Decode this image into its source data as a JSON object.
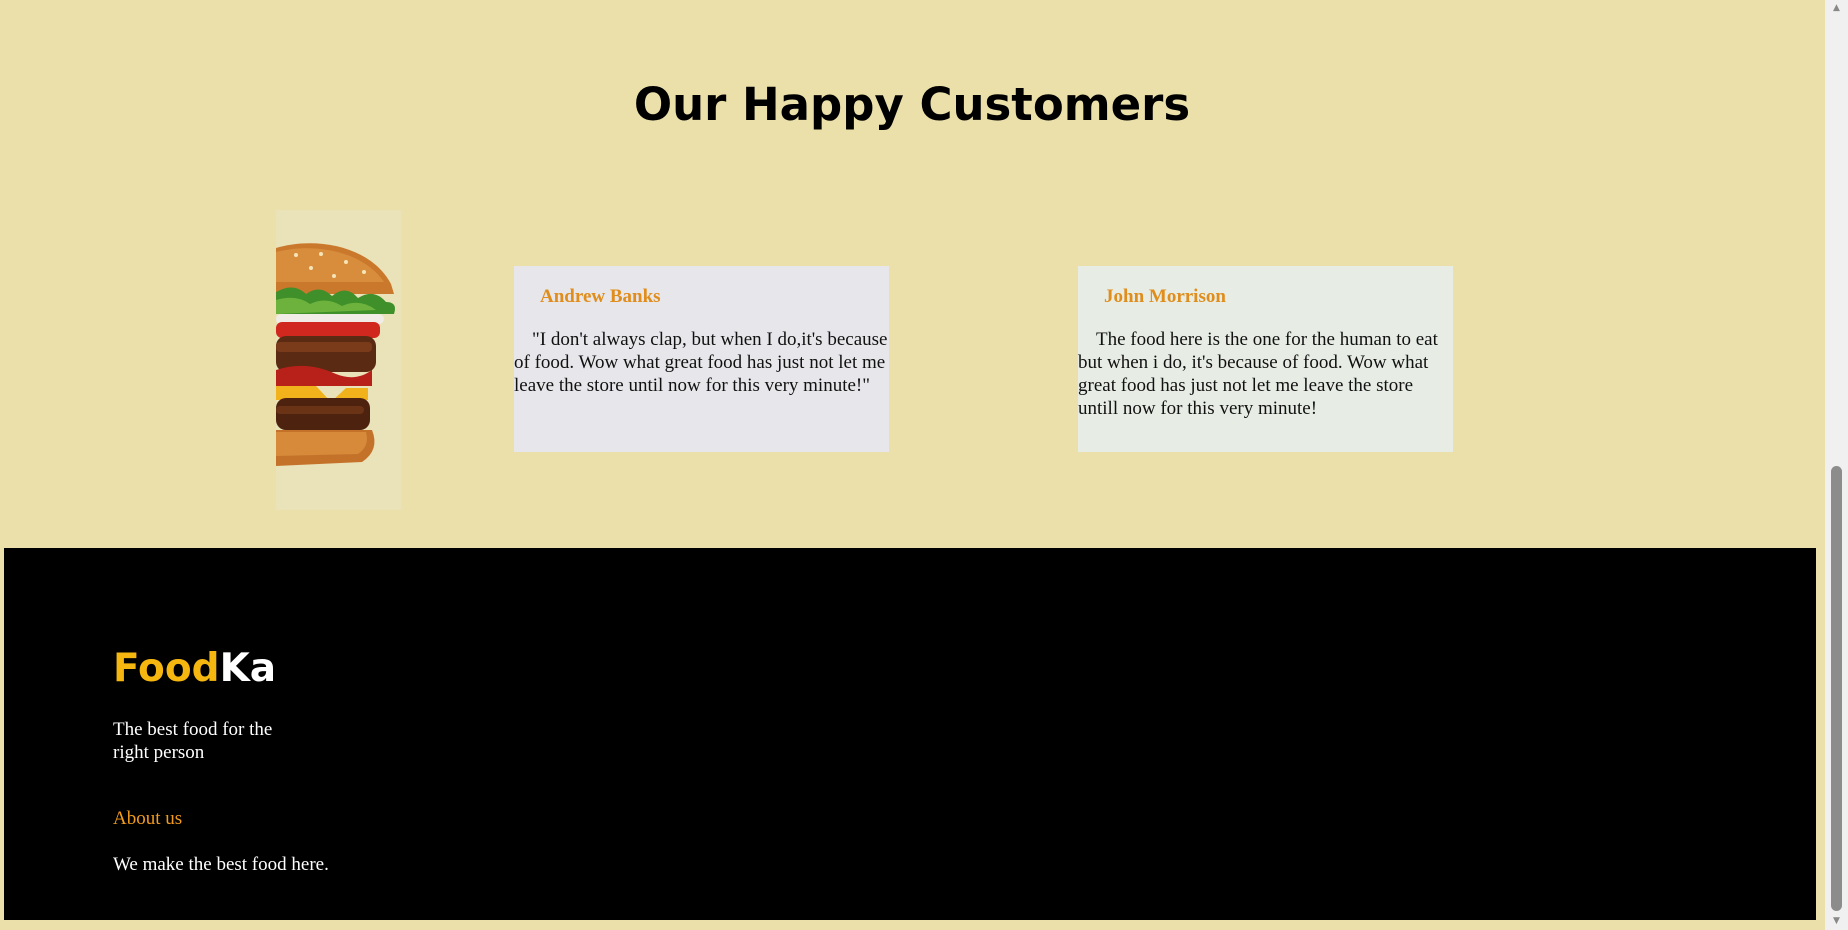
{
  "section": {
    "title": "Our Happy Customers"
  },
  "testimonials": [
    {
      "name": "Andrew Banks",
      "quote": "\"I don't always clap, but when I do,it's because of food. Wow what great food has just not let me leave the store until now for this very minute!\""
    },
    {
      "name": "John Morrison",
      "quote": "The food here is the one for the human to eat but when i do, it's because of food. Wow what great food has just not let me leave the store untill now for this very minute!"
    }
  ],
  "footer": {
    "logo_part1": "Food",
    "logo_part2": "Ka",
    "tagline": "The best food for the right person",
    "about_title": "About us",
    "about_text": "We make the best food here."
  },
  "colors": {
    "background": "#ebe0aa",
    "accent_orange": "#e08d1c",
    "logo_yellow": "#f5b60f",
    "footer_bg": "#000000"
  },
  "icons": {
    "scroll_up": "scroll-up-arrow-icon",
    "scroll_down": "scroll-down-arrow-icon"
  }
}
